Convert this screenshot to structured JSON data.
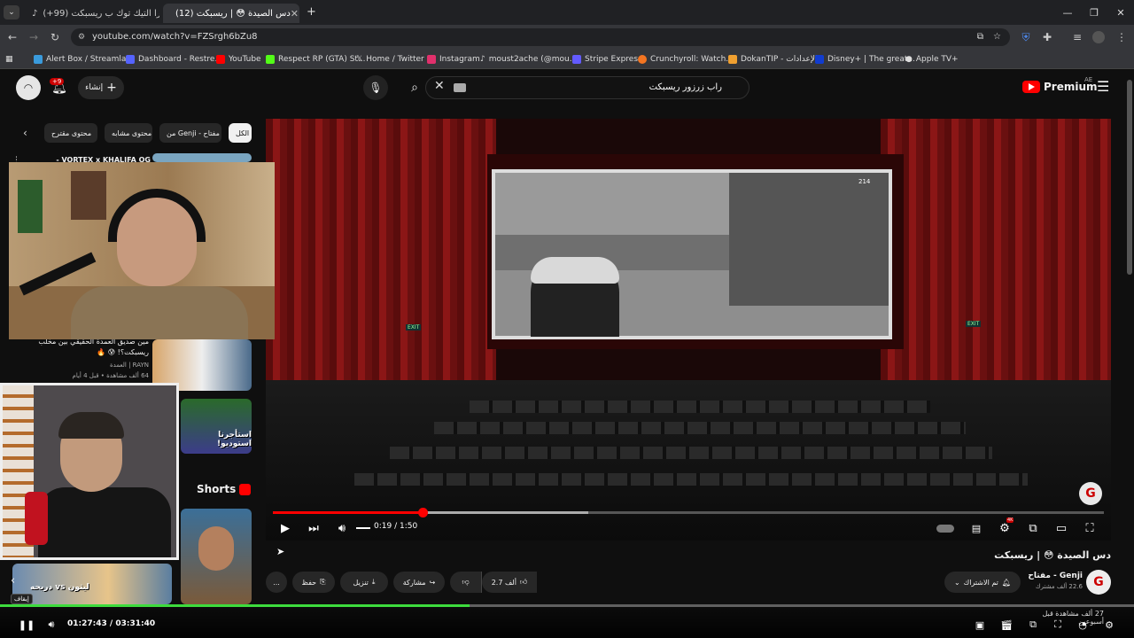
{
  "browser": {
    "tabs": [
      {
        "title": "(+99) اخبرا التيك توك ب ريسبكت..."
      },
      {
        "title": "(12) دس الصيدة 😳 | ريسبكت"
      }
    ],
    "new_tab": "+",
    "url": "youtube.com/watch?v=FZSrgh6bZu8",
    "bookmarks": [
      {
        "label": "Alert Box / Streamla...",
        "color": "#3a9bdc"
      },
      {
        "label": "Dashboard - Restre...",
        "color": "#5563ff"
      },
      {
        "label": "YouTube",
        "color": "#ff0000"
      },
      {
        "label": "Respect RP (GTA) St...",
        "color": "#53fc18"
      },
      {
        "label": "Home / Twitter",
        "color": "#ffffff"
      },
      {
        "label": "Instagram",
        "color": "#e1306c"
      },
      {
        "label": "moust2ache (@mou...",
        "color": "#ffffff"
      },
      {
        "label": "Stripe Express",
        "color": "#635bff"
      },
      {
        "label": "Crunchyroll: Watch...",
        "color": "#f47521"
      },
      {
        "label": "DokanTIP - الإعدادات",
        "color": "#f0a030"
      },
      {
        "label": "Disney+ | The great...",
        "color": "#113ccf"
      },
      {
        "label": "Apple TV+",
        "color": "#dddddd"
      }
    ]
  },
  "youtube": {
    "logo_text": "Premium",
    "logo_region": "AE",
    "search_query": "راب زرزور ريسبكت",
    "create_label": "إنشاء",
    "notif_count": "+9",
    "chips": [
      "الكل",
      "من Genji - مفتاح",
      "محتوى مشابه",
      "محتوى مقترح"
    ],
    "sidebar": {
      "top_title": "VORTEX x KHALIFA OG -",
      "video1": {
        "title": "مين صديق العمدة الحقيقي بين مخلب",
        "title2": "ريسبكت؟! 😰 🔥",
        "channel": "RAYN | العمدة",
        "meta": "64 ألف مشاهدة • قبل 4 أيام"
      },
      "shorts_label": "Shorts",
      "thumb_text": "استأجرنا استوديو!",
      "bottom_text": "ليثون vs دربحه"
    },
    "player": {
      "time_current": "0:19",
      "time_total": "1:50",
      "time_display": "0:19 / 1:50",
      "progress_fraction": 0.18,
      "buffer_fraction": 0.38,
      "settings_badge": "4K",
      "exit_left": "EXIT",
      "exit_right": "EXIT",
      "hud_text": "214"
    },
    "video": {
      "title": "دس الصيدة 😳 | ريسبكت",
      "channel": "Genji - مفتاح",
      "subscribers": "22.6 ألف مشترك",
      "subscribe_label": "تم الاشتراك",
      "likes": "2.7 ألف",
      "share_label": "مشاركة",
      "download_label": "تنزيل",
      "save_label": "حفظ",
      "more_label": "...",
      "views_meta": "27 ألف مشاهدة قبل أسبوعين"
    }
  },
  "stream": {
    "time_display": "01:27:43 / 03:31:40",
    "progress_fraction": 0.414,
    "tooltip": "إيقاف"
  }
}
